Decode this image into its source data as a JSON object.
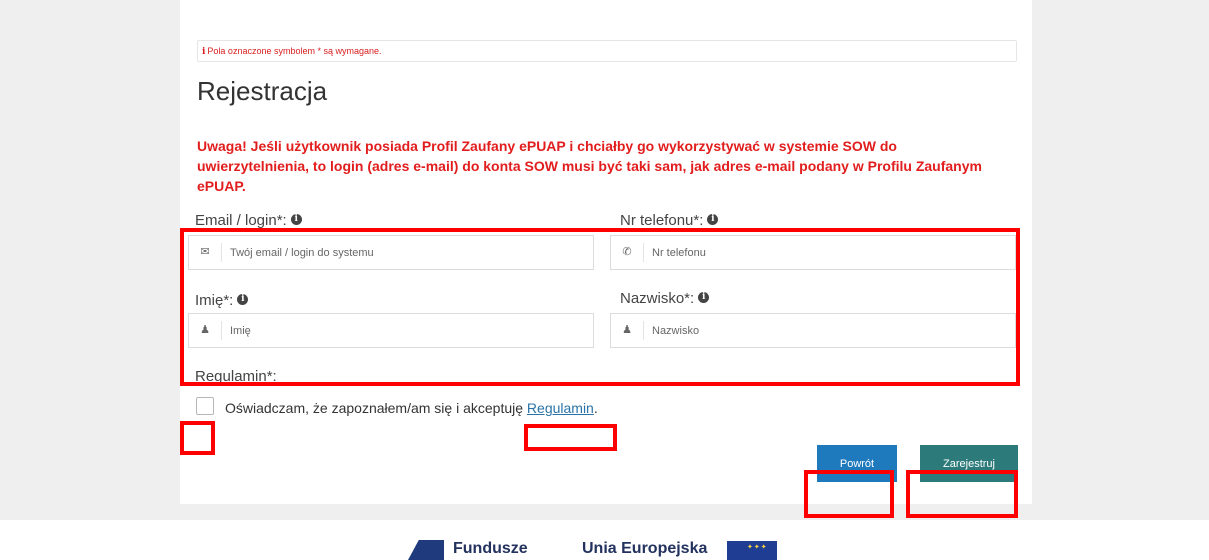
{
  "notice": {
    "icon": "info-icon",
    "text": "Pola oznaczone symbolem * są wymagane."
  },
  "page_title": "Rejestracja",
  "warning": "Uwaga! Jeśli użytkownik posiada Profil Zaufany ePUAP i chciałby go wykorzystywać w systemie SOW do uwierzytelnienia, to login (adres e-mail) do konta SOW musi być taki sam, jak adres e-mail podany w Profilu Zaufanym ePUAP.",
  "form": {
    "email_label": "Email / login*:",
    "email_placeholder": "Twój email / login do systemu",
    "phone_label": "Nr telefonu*:",
    "phone_placeholder": "Nr telefonu",
    "firstname_label": "Imię*:",
    "firstname_placeholder": "Imię",
    "lastname_label": "Nazwisko*:",
    "lastname_placeholder": "Nazwisko",
    "terms_label": "Regulamin*:",
    "consent_text": "Oświadczam, że zapoznałem/am się i akceptuję",
    "terms_link": "Regulamin",
    "consent_suffix": "."
  },
  "buttons": {
    "back": "Powrót",
    "register": "Zarejestruj"
  },
  "footer": {
    "funds_text": "Fundusze",
    "eu_text": "Unia Europejska"
  },
  "colors": {
    "warning": "#e21d1d",
    "back_button": "#1f79bd",
    "register_button": "#2c7b7a",
    "highlight": "#ff0000"
  }
}
